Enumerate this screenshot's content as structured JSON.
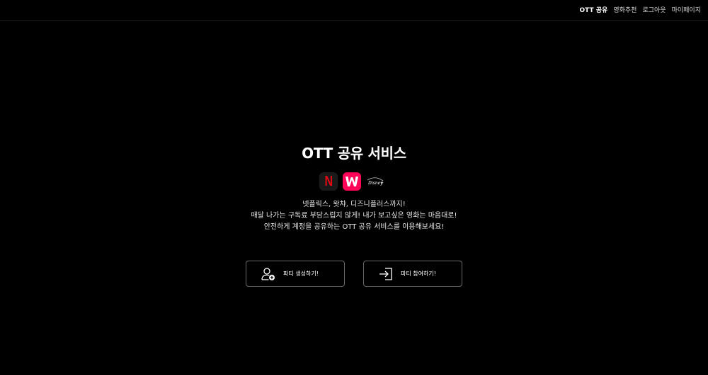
{
  "header": {
    "nav": [
      {
        "label": "OTT 공유",
        "active": true
      },
      {
        "label": "영화추천",
        "active": false
      },
      {
        "label": "로그아웃",
        "active": false
      },
      {
        "label": "마이페이지",
        "active": false
      }
    ]
  },
  "hero": {
    "title": "OTT 공유 서비스",
    "logos": [
      {
        "name": "netflix",
        "glyph": "N",
        "color": "#e50914"
      },
      {
        "name": "watcha",
        "color": "#ff0558"
      },
      {
        "name": "disney-plus",
        "color": "#ffffff"
      }
    ],
    "description": [
      "넷플릭스, 왓챠, 디즈니플러스까지!",
      "매달 나가는 구독료 부담스럽지 않게! 내가 보고싶은 영화는 마음대로!",
      "안전하게 계정을 공유하는 OTT 공유 서비스를 이용해보세요!"
    ]
  },
  "actions": {
    "create_label": "파티 생성하기!",
    "join_label": "파티 참여하기!"
  },
  "colors": {
    "background": "#000000",
    "text": "#ffffff",
    "button_border": "#6a6a6a"
  }
}
